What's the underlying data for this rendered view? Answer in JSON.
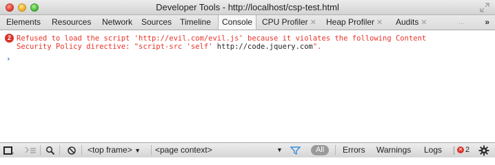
{
  "window": {
    "title": "Developer Tools - http://localhost/csp-test.html"
  },
  "tabs": [
    {
      "label": "Elements"
    },
    {
      "label": "Resources"
    },
    {
      "label": "Network"
    },
    {
      "label": "Sources"
    },
    {
      "label": "Timeline"
    },
    {
      "label": "Console",
      "selected": true
    },
    {
      "label": "CPU Profiler",
      "closable": true
    },
    {
      "label": "Heap Profiler",
      "closable": true
    },
    {
      "label": "Audits",
      "closable": true
    }
  ],
  "tab_more": "...",
  "tab_overflow": "»",
  "console": {
    "error_count_badge": "2",
    "message_line1": "Refused to load the script 'http://evil.com/evil.js' because it violates the following Content",
    "message_line2_prefix": "Security Policy directive: \"script-src 'self' ",
    "message_line2_url": "http://code.jquery.com",
    "message_line2_suffix": "\".",
    "prompt": "›"
  },
  "bottom": {
    "frame_select": "<top frame>",
    "context_select": "<page context>",
    "filter_all": "All",
    "filter_errors": "Errors",
    "filter_warnings": "Warnings",
    "filter_logs": "Logs",
    "error_count": "2"
  },
  "colors": {
    "error": "#e8322a",
    "badge": "#d8332b",
    "prompt": "#3b6fd6"
  }
}
